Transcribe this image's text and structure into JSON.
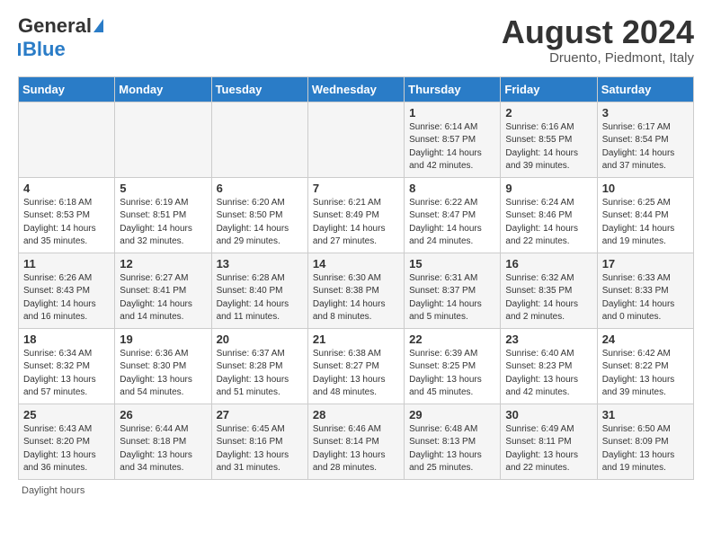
{
  "header": {
    "logo_general": "General",
    "logo_blue": "Blue",
    "month_title": "August 2024",
    "location": "Druento, Piedmont, Italy"
  },
  "days_of_week": [
    "Sunday",
    "Monday",
    "Tuesday",
    "Wednesday",
    "Thursday",
    "Friday",
    "Saturday"
  ],
  "weeks": [
    [
      {
        "day": "",
        "info": ""
      },
      {
        "day": "",
        "info": ""
      },
      {
        "day": "",
        "info": ""
      },
      {
        "day": "",
        "info": ""
      },
      {
        "day": "1",
        "info": "Sunrise: 6:14 AM\nSunset: 8:57 PM\nDaylight: 14 hours\nand 42 minutes."
      },
      {
        "day": "2",
        "info": "Sunrise: 6:16 AM\nSunset: 8:55 PM\nDaylight: 14 hours\nand 39 minutes."
      },
      {
        "day": "3",
        "info": "Sunrise: 6:17 AM\nSunset: 8:54 PM\nDaylight: 14 hours\nand 37 minutes."
      }
    ],
    [
      {
        "day": "4",
        "info": "Sunrise: 6:18 AM\nSunset: 8:53 PM\nDaylight: 14 hours\nand 35 minutes."
      },
      {
        "day": "5",
        "info": "Sunrise: 6:19 AM\nSunset: 8:51 PM\nDaylight: 14 hours\nand 32 minutes."
      },
      {
        "day": "6",
        "info": "Sunrise: 6:20 AM\nSunset: 8:50 PM\nDaylight: 14 hours\nand 29 minutes."
      },
      {
        "day": "7",
        "info": "Sunrise: 6:21 AM\nSunset: 8:49 PM\nDaylight: 14 hours\nand 27 minutes."
      },
      {
        "day": "8",
        "info": "Sunrise: 6:22 AM\nSunset: 8:47 PM\nDaylight: 14 hours\nand 24 minutes."
      },
      {
        "day": "9",
        "info": "Sunrise: 6:24 AM\nSunset: 8:46 PM\nDaylight: 14 hours\nand 22 minutes."
      },
      {
        "day": "10",
        "info": "Sunrise: 6:25 AM\nSunset: 8:44 PM\nDaylight: 14 hours\nand 19 minutes."
      }
    ],
    [
      {
        "day": "11",
        "info": "Sunrise: 6:26 AM\nSunset: 8:43 PM\nDaylight: 14 hours\nand 16 minutes."
      },
      {
        "day": "12",
        "info": "Sunrise: 6:27 AM\nSunset: 8:41 PM\nDaylight: 14 hours\nand 14 minutes."
      },
      {
        "day": "13",
        "info": "Sunrise: 6:28 AM\nSunset: 8:40 PM\nDaylight: 14 hours\nand 11 minutes."
      },
      {
        "day": "14",
        "info": "Sunrise: 6:30 AM\nSunset: 8:38 PM\nDaylight: 14 hours\nand 8 minutes."
      },
      {
        "day": "15",
        "info": "Sunrise: 6:31 AM\nSunset: 8:37 PM\nDaylight: 14 hours\nand 5 minutes."
      },
      {
        "day": "16",
        "info": "Sunrise: 6:32 AM\nSunset: 8:35 PM\nDaylight: 14 hours\nand 2 minutes."
      },
      {
        "day": "17",
        "info": "Sunrise: 6:33 AM\nSunset: 8:33 PM\nDaylight: 14 hours\nand 0 minutes."
      }
    ],
    [
      {
        "day": "18",
        "info": "Sunrise: 6:34 AM\nSunset: 8:32 PM\nDaylight: 13 hours\nand 57 minutes."
      },
      {
        "day": "19",
        "info": "Sunrise: 6:36 AM\nSunset: 8:30 PM\nDaylight: 13 hours\nand 54 minutes."
      },
      {
        "day": "20",
        "info": "Sunrise: 6:37 AM\nSunset: 8:28 PM\nDaylight: 13 hours\nand 51 minutes."
      },
      {
        "day": "21",
        "info": "Sunrise: 6:38 AM\nSunset: 8:27 PM\nDaylight: 13 hours\nand 48 minutes."
      },
      {
        "day": "22",
        "info": "Sunrise: 6:39 AM\nSunset: 8:25 PM\nDaylight: 13 hours\nand 45 minutes."
      },
      {
        "day": "23",
        "info": "Sunrise: 6:40 AM\nSunset: 8:23 PM\nDaylight: 13 hours\nand 42 minutes."
      },
      {
        "day": "24",
        "info": "Sunrise: 6:42 AM\nSunset: 8:22 PM\nDaylight: 13 hours\nand 39 minutes."
      }
    ],
    [
      {
        "day": "25",
        "info": "Sunrise: 6:43 AM\nSunset: 8:20 PM\nDaylight: 13 hours\nand 36 minutes."
      },
      {
        "day": "26",
        "info": "Sunrise: 6:44 AM\nSunset: 8:18 PM\nDaylight: 13 hours\nand 34 minutes."
      },
      {
        "day": "27",
        "info": "Sunrise: 6:45 AM\nSunset: 8:16 PM\nDaylight: 13 hours\nand 31 minutes."
      },
      {
        "day": "28",
        "info": "Sunrise: 6:46 AM\nSunset: 8:14 PM\nDaylight: 13 hours\nand 28 minutes."
      },
      {
        "day": "29",
        "info": "Sunrise: 6:48 AM\nSunset: 8:13 PM\nDaylight: 13 hours\nand 25 minutes."
      },
      {
        "day": "30",
        "info": "Sunrise: 6:49 AM\nSunset: 8:11 PM\nDaylight: 13 hours\nand 22 minutes."
      },
      {
        "day": "31",
        "info": "Sunrise: 6:50 AM\nSunset: 8:09 PM\nDaylight: 13 hours\nand 19 minutes."
      }
    ]
  ],
  "footer": {
    "daylight_label": "Daylight hours"
  }
}
